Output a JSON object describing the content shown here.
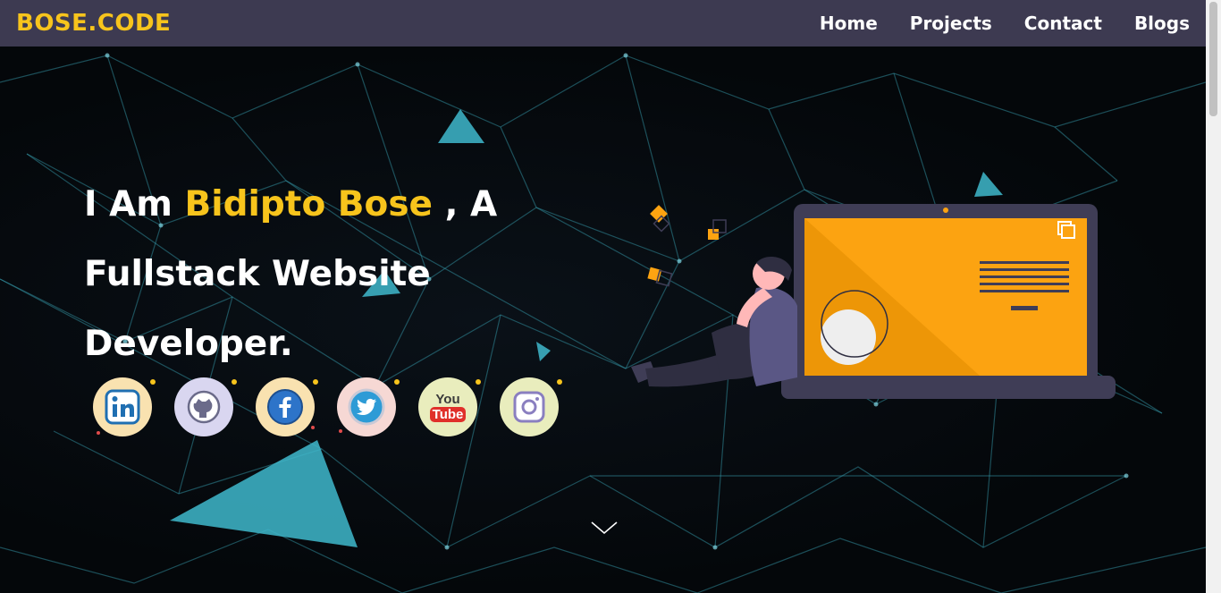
{
  "nav": {
    "logo": "BOSE.CODE",
    "links": [
      "Home",
      "Projects",
      "Contact",
      "Blogs"
    ]
  },
  "hero": {
    "line1_prefix": "I Am ",
    "name": "Bidipto Bose",
    "line1_suffix": " , A",
    "line2": "Fullstack Website",
    "line3": "Developer."
  },
  "socials": [
    {
      "name": "linkedin",
      "label": "in",
      "bg": "#f9e2b0",
      "fg": "#1f6fb2"
    },
    {
      "name": "github",
      "label": "",
      "bg": "#d9d6f0",
      "fg": "#6b6b8a"
    },
    {
      "name": "facebook",
      "label": "f",
      "bg": "#f9e2b0",
      "fg": "#2d74c9"
    },
    {
      "name": "twitter",
      "label": "",
      "bg": "#f6d8d4",
      "fg": "#2d9bd6"
    },
    {
      "name": "youtube",
      "label_top": "You",
      "label_bottom": "Tube",
      "bg": "#e9edbd",
      "fg": "#e0302a"
    },
    {
      "name": "instagram",
      "label": "",
      "bg": "#e9edbd",
      "fg": "#8a7fc0"
    }
  ],
  "colors": {
    "accent": "#f7c41c",
    "navbar": "#3d3a51",
    "laptop_screen": "#fca311",
    "laptop_body": "#3f3d56"
  },
  "icons": {
    "scroll_down": "chevron-down-icon"
  }
}
